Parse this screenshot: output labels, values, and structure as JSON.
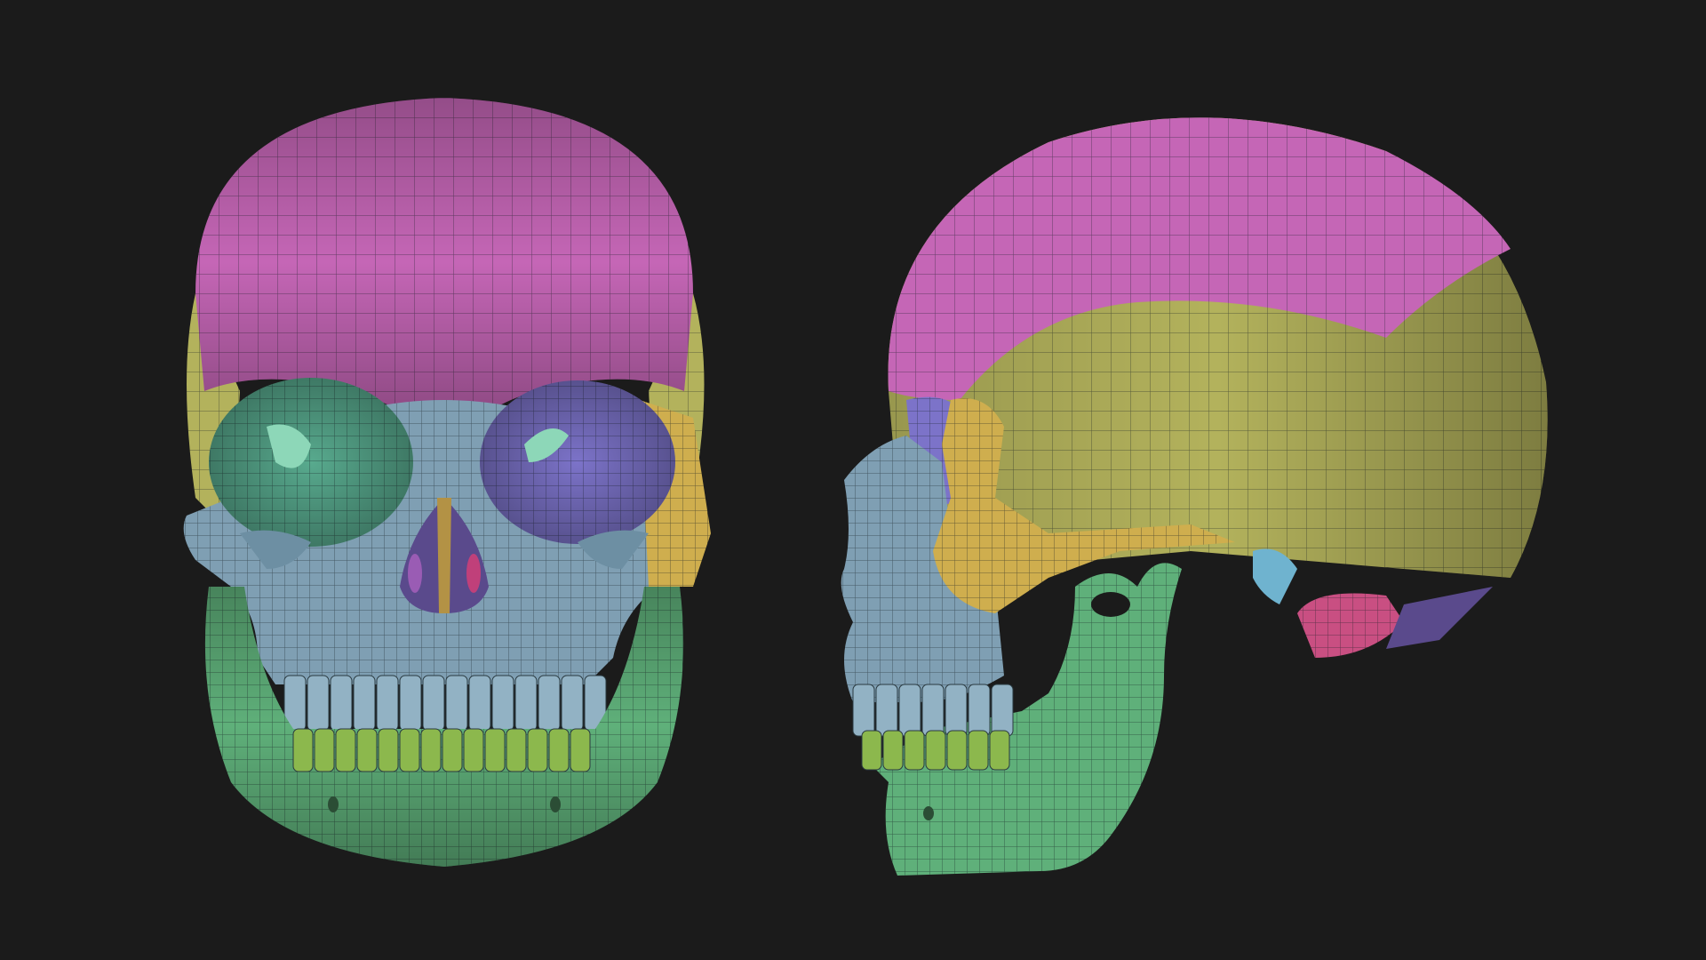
{
  "scene": {
    "background_color": "#1b1b1b",
    "views": [
      {
        "view": "front"
      },
      {
        "view": "side"
      }
    ]
  },
  "palette": {
    "frontal_bone": "#c566b6",
    "parietal_bone": "#b3b25c",
    "temporal_zygomatic": "#cfae4e",
    "facial_maxilla": "#7f9fb3",
    "orbit_lining": "#58aa8e",
    "sphenoid_orbit": "#7c73c9",
    "mandible": "#5fb07a",
    "lower_teeth": "#8cb84d",
    "upper_teeth": "#92b2c4",
    "occipital": "#c94f82",
    "mesh_lines": "#1e2a2f"
  }
}
